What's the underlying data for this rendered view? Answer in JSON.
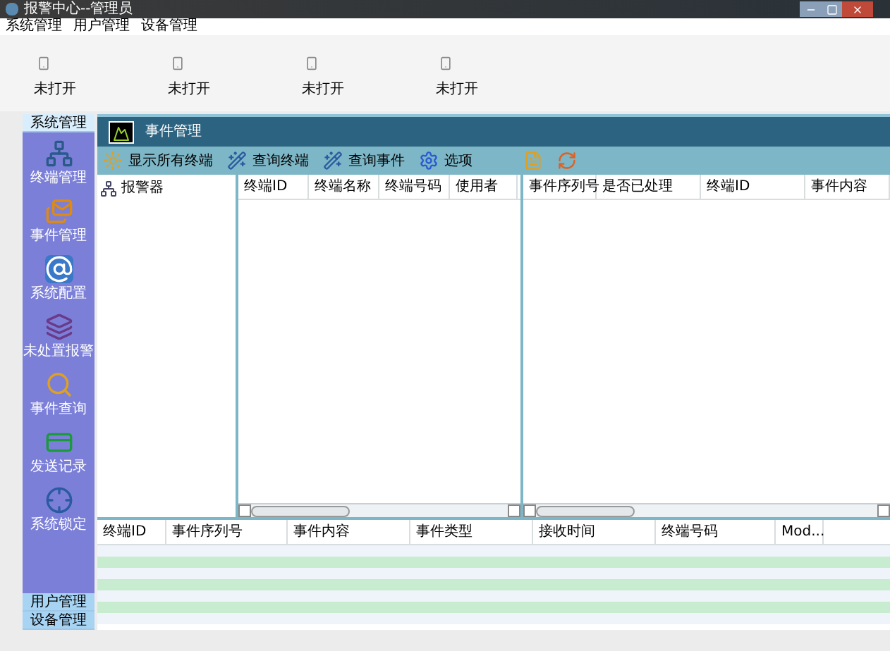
{
  "window": {
    "title": "报警中心--管理员"
  },
  "menu": [
    "系统管理",
    "用户管理",
    "设备管理"
  ],
  "devices": [
    {
      "label": "未打开"
    },
    {
      "label": "未打开"
    },
    {
      "label": "未打开"
    },
    {
      "label": "未打开"
    }
  ],
  "sidebar": {
    "sections": [
      {
        "label": "系统管理",
        "expanded": true,
        "items": [
          "终端管理",
          "事件管理",
          "系统配置",
          "未处置报警",
          "事件查询",
          "发送记录",
          "系统锁定"
        ]
      },
      {
        "label": "用户管理",
        "expanded": false
      },
      {
        "label": "设备管理",
        "expanded": false
      }
    ]
  },
  "panel": {
    "title": "事件管理",
    "toolbar": [
      {
        "label": "显示所有终端"
      },
      {
        "label": "查询终端"
      },
      {
        "label": "查询事件"
      },
      {
        "label": "选项"
      }
    ],
    "tree": {
      "root": "报警器"
    },
    "terminals_table": {
      "columns": [
        "终端ID",
        "终端名称",
        "终端号码",
        "使用者"
      ]
    },
    "events_table": {
      "columns": [
        "事件序列号",
        "是否已处理",
        "终端ID",
        "事件内容"
      ]
    },
    "log_table": {
      "columns": [
        "终端ID",
        "事件序列号",
        "事件内容",
        "事件类型",
        "接收时间",
        "终端号码",
        "Mod..."
      ]
    }
  }
}
